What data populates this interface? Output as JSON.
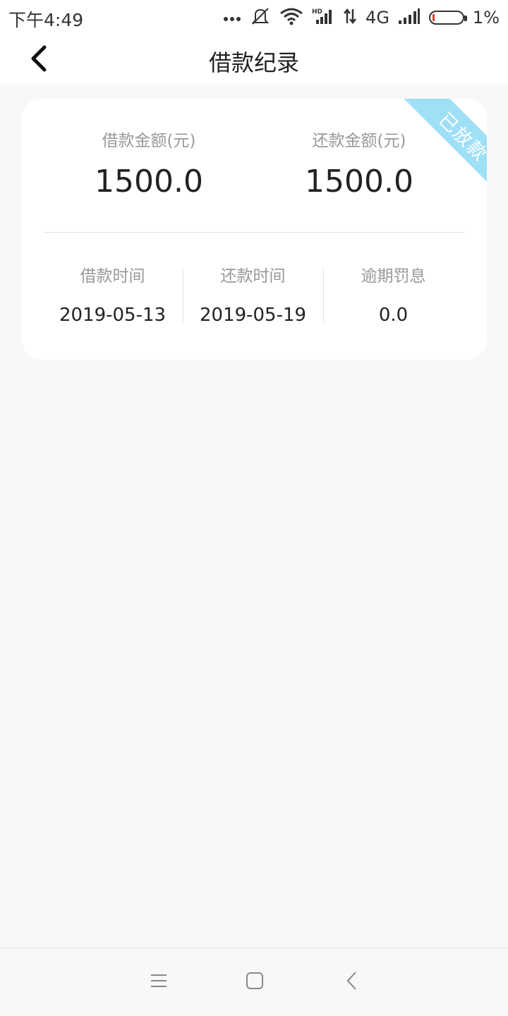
{
  "status_bar": {
    "time": "下午4:49",
    "network": "4G",
    "battery_percent": "1%",
    "icons": [
      "more-dots-icon",
      "silent-icon",
      "wifi-icon",
      "hd-signal-icon",
      "data-arrows-icon",
      "signal-icon",
      "battery-icon"
    ]
  },
  "header": {
    "title": "借款纪录",
    "back_icon": "chevron-left-icon"
  },
  "record": {
    "status_ribbon": "已放款",
    "status_color": "#9fe0f7",
    "loan_amount_label": "借款金额(元)",
    "loan_amount_value": "1500.0",
    "repay_amount_label": "还款金额(元)",
    "repay_amount_value": "1500.0",
    "loan_date_label": "借款时间",
    "loan_date_value": "2019-05-13",
    "repay_date_label": "还款时间",
    "repay_date_value": "2019-05-19",
    "penalty_label": "逾期罚息",
    "penalty_value": "0.0"
  },
  "nav_bar": {
    "icons": [
      "menu-icon",
      "home-icon",
      "back-icon"
    ]
  }
}
